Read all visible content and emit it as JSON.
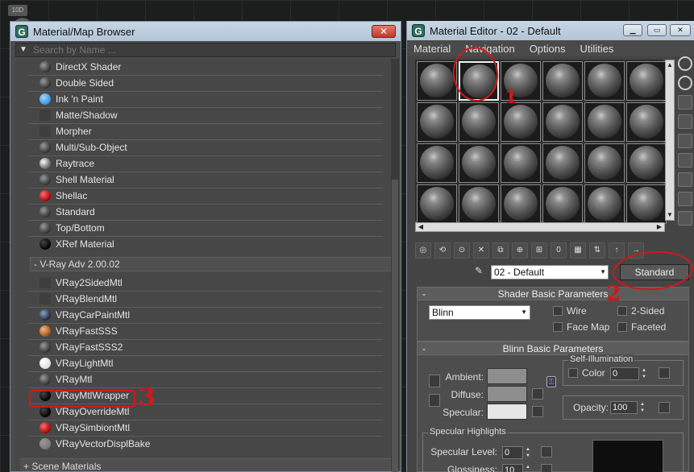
{
  "background": {
    "tab_label": "10D"
  },
  "browser": {
    "title": "Material/Map Browser",
    "close_label": "✕",
    "search_placeholder": "Search by Name ...",
    "materials": [
      {
        "label": "DirectX Shader",
        "icon": "sphere"
      },
      {
        "label": "Double Sided",
        "icon": "sphere"
      },
      {
        "label": "Ink 'n Paint",
        "icon": "blue-sphere"
      },
      {
        "label": "Matte/Shadow",
        "icon": "square"
      },
      {
        "label": "Morpher",
        "icon": "square"
      },
      {
        "label": "Multi/Sub-Object",
        "icon": "sphere"
      },
      {
        "label": "Raytrace",
        "icon": "ray-sphere"
      },
      {
        "label": "Shell Material",
        "icon": "sphere"
      },
      {
        "label": "Shellac",
        "icon": "red-sphere"
      },
      {
        "label": "Standard",
        "icon": "sphere"
      },
      {
        "label": "Top/Bottom",
        "icon": "sphere"
      },
      {
        "label": "XRef Material",
        "icon": "black-sphere"
      }
    ],
    "vray_group_label": "- V-Ray Adv 2.00.02",
    "vray_materials": [
      {
        "label": "VRay2SidedMtl",
        "icon": "square"
      },
      {
        "label": "VRayBlendMtl",
        "icon": "square"
      },
      {
        "label": "VRayCarPaintMtl",
        "icon": "car-sphere"
      },
      {
        "label": "VRayFastSSS",
        "icon": "orange-sphere"
      },
      {
        "label": "VRayFastSSS2",
        "icon": "sphere"
      },
      {
        "label": "VRayLightMtl",
        "icon": "white-sphere"
      },
      {
        "label": "VRayMtl",
        "icon": "sphere"
      },
      {
        "label": "VRayMtlWrapper",
        "icon": "black-sphere"
      },
      {
        "label": "VRayOverrideMtl",
        "icon": "black-sphere"
      },
      {
        "label": "VRaySimbiontMtl",
        "icon": "red-sphere"
      },
      {
        "label": "VRayVectorDisplBake",
        "icon": "grey-sphere"
      }
    ],
    "scene_group_label": "+ Scene Materials"
  },
  "editor": {
    "title": "Material Editor - 02 - Default",
    "menu": [
      "Material",
      "Navigation",
      "Options",
      "Utilities"
    ],
    "active_slot": 1,
    "slot_count": 24,
    "material_name": "02 - Default",
    "material_type_button": "Standard",
    "shader_rollout": {
      "title": "Shader Basic Parameters",
      "shader": "Blinn",
      "options": [
        {
          "label": "Wire",
          "checked": false
        },
        {
          "label": "2-Sided",
          "checked": false
        },
        {
          "label": "Face Map",
          "checked": false
        },
        {
          "label": "Faceted",
          "checked": false
        }
      ]
    },
    "blinn_rollout": {
      "title": "Blinn Basic Parameters",
      "ambient_label": "Ambient:",
      "diffuse_label": "Diffuse:",
      "specular_label": "Specular:",
      "ambient_color": "#8e8e8e",
      "diffuse_color": "#8e8e8e",
      "specular_color": "#e6e6e6",
      "self_illum_title": "Self-Illumination",
      "self_illum_color_label": "Color",
      "self_illum_value": "0",
      "opacity_label": "Opacity:",
      "opacity_value": "100",
      "spec_highlights_title": "Specular Highlights",
      "spec_level_label": "Specular Level:",
      "spec_level_value": "0",
      "glossiness_label": "Glossiness:",
      "glossiness_value": "10"
    }
  },
  "annotations": [
    "1",
    "2",
    "3"
  ],
  "colors": {
    "annotation_red": "#d01818",
    "titlebar": "#c7d6e4"
  }
}
